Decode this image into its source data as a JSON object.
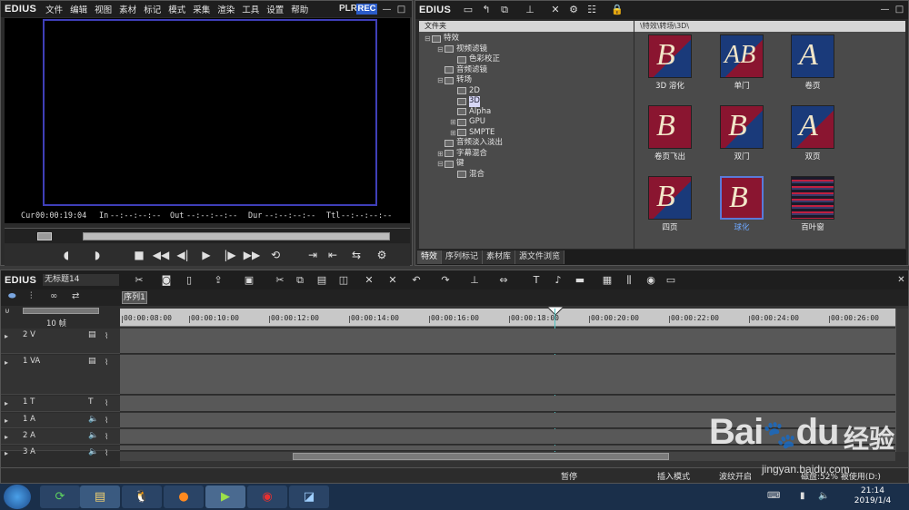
{
  "player": {
    "brand": "EDIUS",
    "menu": [
      "文件",
      "编辑",
      "视图",
      "素材",
      "标记",
      "模式",
      "采集",
      "渲染",
      "工具",
      "设置",
      "帮助"
    ],
    "plr": "PLR",
    "rec": "REC",
    "timecodes": {
      "cur_label": "Cur",
      "cur": "00:00:19:04",
      "in_label": "In",
      "in": "--:--:--:--",
      "out_label": "Out",
      "out": "--:--:--:--",
      "dur_label": "Dur",
      "dur": "--:--:--:--",
      "ttl_label": "Ttl",
      "ttl": "--:--:--:--"
    },
    "window_buttons": [
      "—",
      "□"
    ]
  },
  "library": {
    "brand": "EDIUS",
    "folder_header": "文件夹",
    "path": "\\特效\\转场\\3D\\",
    "tree": [
      {
        "label": "特效",
        "level": 0,
        "exp": "⊟"
      },
      {
        "label": "视频滤镜",
        "level": 1,
        "exp": "⊟"
      },
      {
        "label": "色彩校正",
        "level": 2,
        "exp": ""
      },
      {
        "label": "音频滤镜",
        "level": 1,
        "exp": ""
      },
      {
        "label": "转场",
        "level": 1,
        "exp": "⊟"
      },
      {
        "label": "2D",
        "level": 2,
        "exp": ""
      },
      {
        "label": "3D",
        "level": 2,
        "exp": "",
        "selected": true
      },
      {
        "label": "Alpha",
        "level": 2,
        "exp": ""
      },
      {
        "label": "GPU",
        "level": 2,
        "exp": "⊞"
      },
      {
        "label": "SMPTE",
        "level": 2,
        "exp": "⊞"
      },
      {
        "label": "音频淡入淡出",
        "level": 1,
        "exp": ""
      },
      {
        "label": "字幕混合",
        "level": 1,
        "exp": "⊞"
      },
      {
        "label": "键",
        "level": 1,
        "exp": "⊟"
      },
      {
        "label": "混合",
        "level": 2,
        "exp": ""
      }
    ],
    "thumbnails": [
      {
        "label": "3D 溶化",
        "letter": "B",
        "bg": "#8a1530",
        "fg": "#1a3a7a"
      },
      {
        "label": "单门",
        "letter": "AB",
        "bg": "#1a3a7a",
        "fg": "#8a1530"
      },
      {
        "label": "卷页",
        "letter": "A",
        "bg": "#1a3a7a",
        "fg": "#1a3a7a"
      },
      {
        "label": "卷页飞出",
        "letter": "B",
        "bg": "#8a1530",
        "fg": "#8a1530"
      },
      {
        "label": "双门",
        "letter": "B",
        "bg": "#8a1530",
        "fg": "#1a3a7a"
      },
      {
        "label": "双页",
        "letter": "A",
        "bg": "#1a3a7a",
        "fg": "#8a1530"
      },
      {
        "label": "四页",
        "letter": "B",
        "bg": "#8a1530",
        "fg": "#1a3a7a"
      },
      {
        "label": "球化",
        "letter": "B",
        "bg": "#8a1530",
        "fg": "#8a1530",
        "selected": true
      },
      {
        "label": "百叶窗",
        "letter": "",
        "bg": "#2a1a3a",
        "fg": "#c02040"
      }
    ],
    "tabs": [
      "特效",
      "序列标记",
      "素材库",
      "源文件浏览"
    ]
  },
  "timeline": {
    "brand": "EDIUS",
    "sequence_name": "无标题14",
    "sequence_tab": "序列1",
    "zoom": "10 帧",
    "ruler": [
      "00:00:08:00",
      "00:00:10:00",
      "00:00:12:00",
      "00:00:14:00",
      "00:00:16:00",
      "00:00:18:00",
      "00:00:20:00",
      "00:00:22:00",
      "00:00:24:00",
      "00:00:26:00"
    ],
    "tracks": [
      {
        "name": "2 V",
        "type": "V"
      },
      {
        "name": "1 VA",
        "type": "VA"
      },
      {
        "name": "1 T",
        "type": "T"
      },
      {
        "name": "1 A",
        "type": "A"
      },
      {
        "name": "2 A",
        "type": "A"
      },
      {
        "name": "3 A",
        "type": "A"
      }
    ],
    "status": {
      "pause": "暂停",
      "insert": "插入模式",
      "ripple": "波纹开启",
      "disk": "磁盘:52% 被使用(D:)"
    }
  },
  "taskbar": {
    "time": "21:14",
    "date": "2019/1/4"
  },
  "watermark": {
    "brand": "Bai",
    "brand2": "du",
    "product": "经验",
    "url": "jingyan.baidu.com"
  }
}
